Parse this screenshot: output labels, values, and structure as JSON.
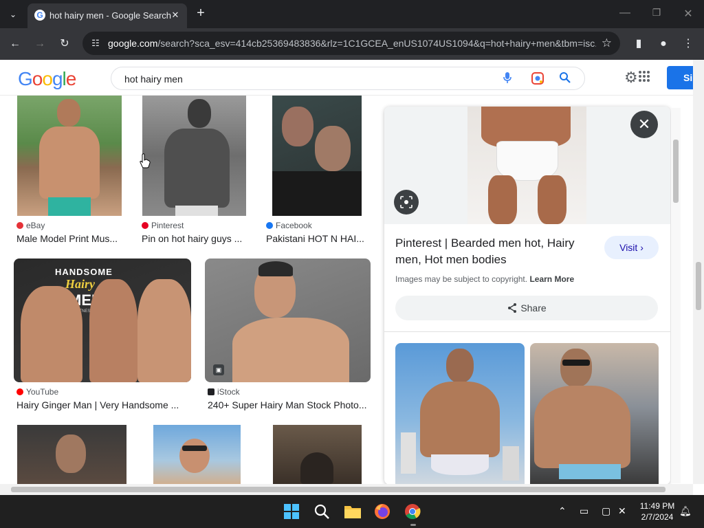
{
  "browser": {
    "tab_title": "hot hairy men - Google Search",
    "tab_close": "✕",
    "new_tab": "+",
    "url_prefix": "google.com",
    "url_rest": "/search?sca_esv=414cb25369483836&rlz=1C1GCEA_enUS1074US1094&q=hot+hairy+men&tbm=isc..."
  },
  "google": {
    "logo": "Google",
    "query": "hot hairy men",
    "signin_label": "Si"
  },
  "results": [
    {
      "source": "eBay",
      "caption": "Male Model Print Mus...",
      "source_color": "#e53238"
    },
    {
      "source": "Pinterest",
      "caption": "Pin on hot hairy guys ...",
      "source_color": "#e60023"
    },
    {
      "source": "Facebook",
      "caption": "Pakistani HOT N HAI...",
      "source_color": "#1877f2"
    },
    {
      "source": "YouTube",
      "caption": "Hairy Ginger Man | Very Handsome ...",
      "source_color": "#ff0000"
    },
    {
      "source": "iStock",
      "caption": "240+ Super Hairy Man Stock Photo...",
      "source_color": "#202124"
    }
  ],
  "thumb_text": {
    "handsome": "HANDSOME",
    "hairy": "Hairy",
    "men": "MEN",
    "fitness": "FITNESS"
  },
  "panel": {
    "title": "Pinterest | Bearded men hot, Hairy men, Hot men bodies",
    "visit_label": "Visit",
    "copyright_text": "Images may be subject to copyright.",
    "learn_more": "Learn More",
    "share_label": "Share",
    "close_glyph": "✕"
  },
  "taskbar": {
    "time": "11:49 PM",
    "date": "2/7/2024"
  }
}
